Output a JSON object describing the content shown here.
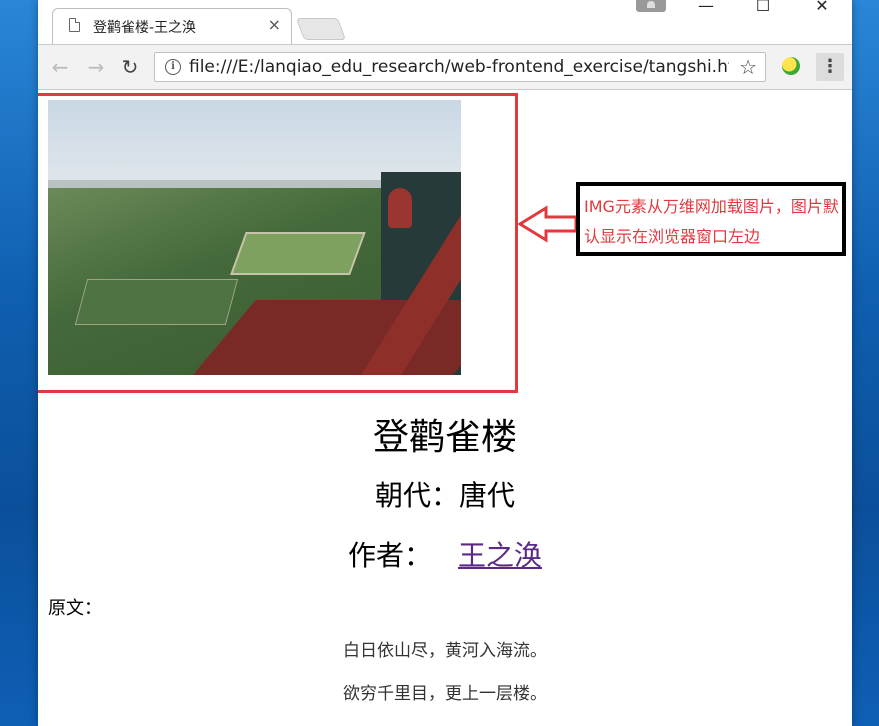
{
  "browser": {
    "tab_title": "登鹳雀楼-王之涣",
    "tab_close": "×",
    "url": "file:///E:/lanqiao_edu_research/web-frontend_exercise/tangshi.ht",
    "back_icon": "←",
    "forward_icon": "→",
    "reload_icon": "↻",
    "info_icon": "i",
    "star_icon": "☆",
    "menu_icon": "⋮",
    "minimize": "—",
    "maximize": "☐",
    "close": "✕"
  },
  "annotation": {
    "text": "IMG元素从万维网加载图片，图片默认显示在浏览器窗口左边",
    "color": "#e0393e"
  },
  "page": {
    "title": "登鹳雀楼",
    "dynasty": "朝代：唐代",
    "author_label": "作者：",
    "author_name": "王之涣",
    "original_label": "原文：",
    "verses": [
      "白日依山尽，黄河入海流。",
      "欲穷千里目，更上一层楼。"
    ]
  }
}
